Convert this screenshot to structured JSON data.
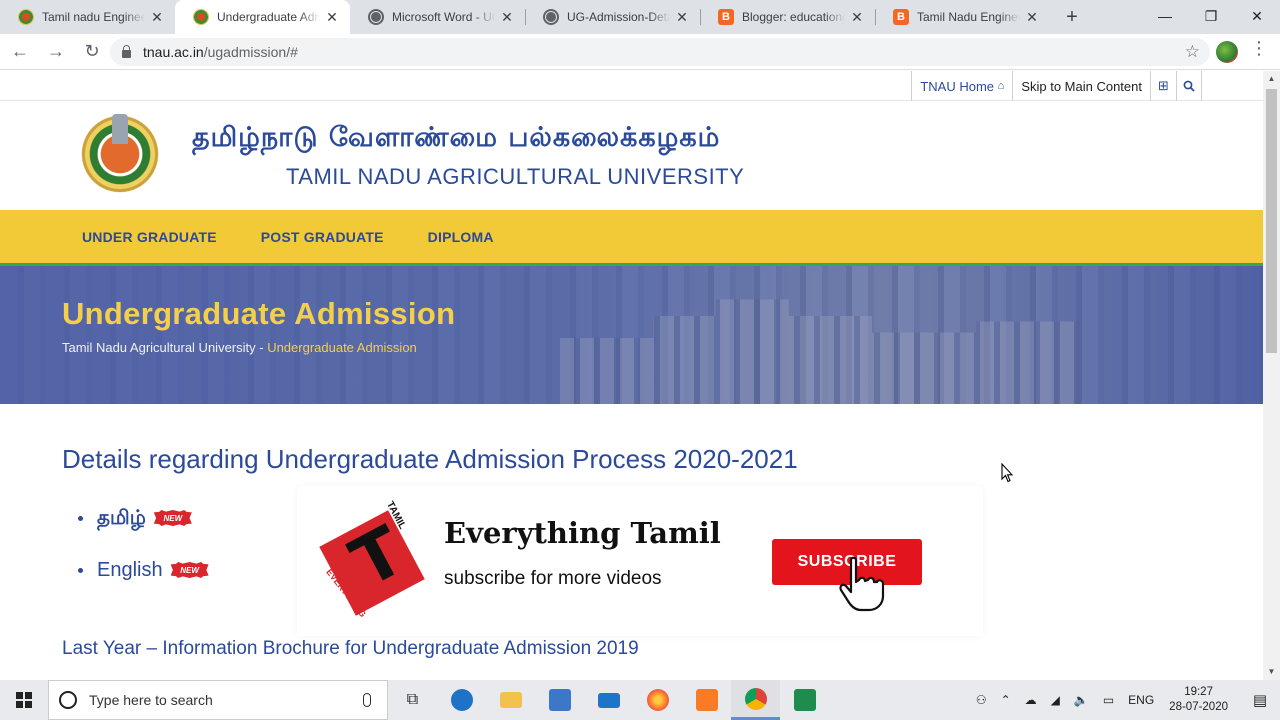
{
  "browser": {
    "tabs": [
      {
        "title": "Tamil nadu Engineering",
        "icon": "emblem-icon",
        "active": false
      },
      {
        "title": "Undergraduate Admission",
        "icon": "emblem-icon",
        "active": true
      },
      {
        "title": "Microsoft Word - UG",
        "icon": "globe-icon",
        "active": false
      },
      {
        "title": "UG-Admission-Details",
        "icon": "globe-icon",
        "active": false
      },
      {
        "title": "Blogger: educationg",
        "icon": "blogger-icon",
        "active": false
      },
      {
        "title": "Tamil Nadu Engineering",
        "icon": "blogger-icon",
        "active": false
      }
    ],
    "address": {
      "host": "tnau.ac.in",
      "path": "/ugadmission/#"
    }
  },
  "page": {
    "topbar": {
      "home": "TNAU Home",
      "skip": "Skip to Main Content"
    },
    "header": {
      "tamil_title": "தமிழ்நாடு வேளாண்மை பல்கலைக்கழகம்",
      "english_title": "TAMIL NADU AGRICULTURAL UNIVERSITY"
    },
    "nav": [
      "UNDER GRADUATE",
      "POST GRADUATE",
      "DIPLOMA"
    ],
    "banner": {
      "heading": "Undergraduate Admission",
      "breadcrumb_root": "Tamil Nadu Agricultural University",
      "breadcrumb_sep": " - ",
      "breadcrumb_current": "Undergraduate Admission"
    },
    "content": {
      "heading": "Details regarding Undergraduate Admission Process 2020-2021",
      "languages": [
        {
          "label": "தமிழ்",
          "badge": "NEW"
        },
        {
          "label": "English",
          "badge": "NEW"
        }
      ],
      "brochure_heading": "Last Year – Information Brochure for Undergraduate Admission 2019"
    }
  },
  "overlay": {
    "logo_top": "TAMIL",
    "logo_bottom": "EVERYTHING",
    "logo_letter": "T",
    "title": "Everything Tamil",
    "subtitle": "subscribe for more videos",
    "button": "SUBSCRIBE"
  },
  "taskbar": {
    "search_placeholder": "Type here to search",
    "language": "ENG",
    "time": "19:27",
    "date": "28-07-2020"
  },
  "colors": {
    "brand_blue": "#2b4a9a",
    "nav_yellow": "#f2c937",
    "accent_green": "#34a853",
    "subscribe_red": "#e3141b"
  }
}
